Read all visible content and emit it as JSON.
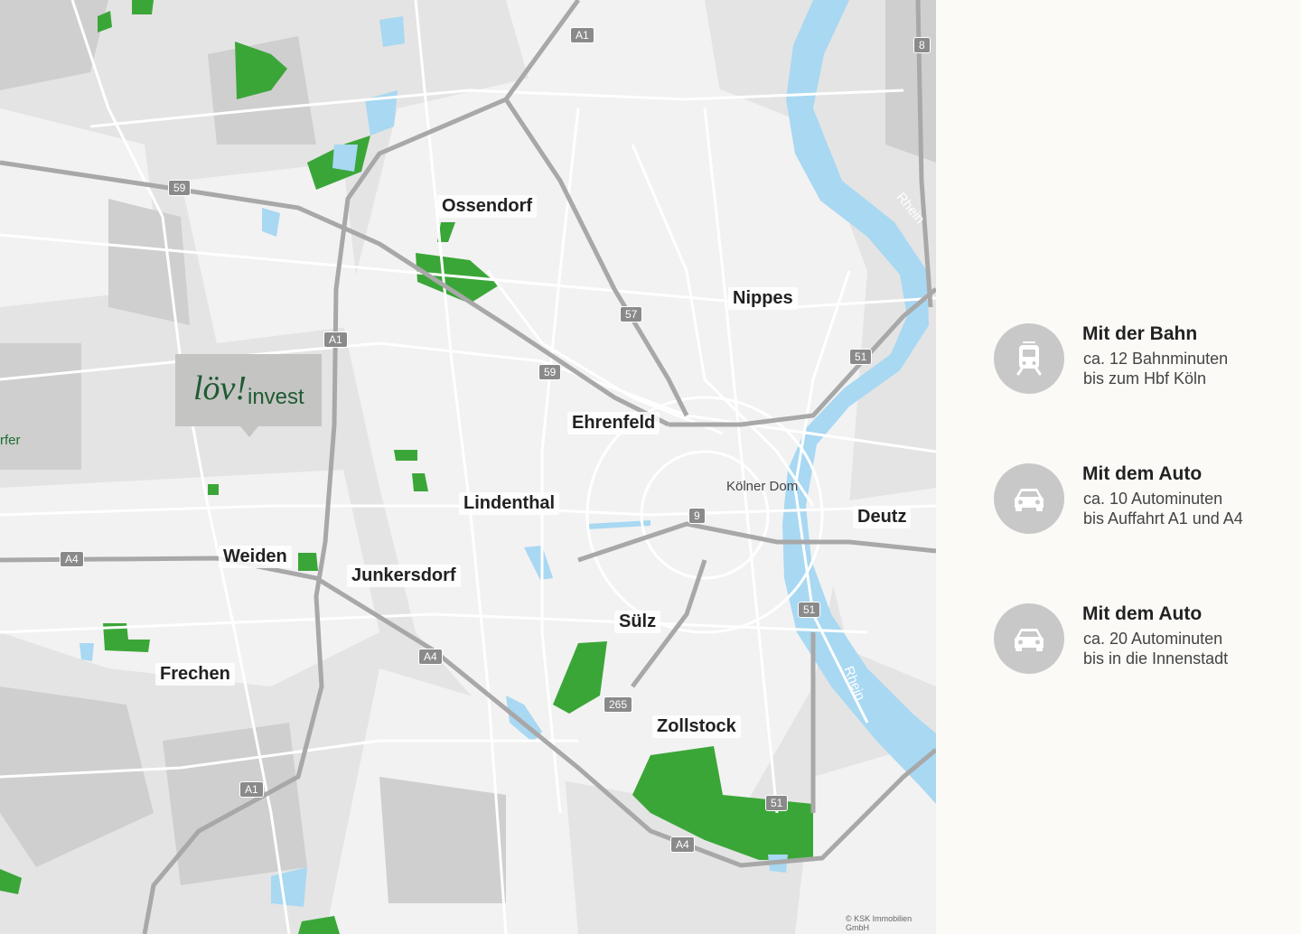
{
  "map": {
    "districts": [
      "Ossendorf",
      "Nippes",
      "Ehrenfeld",
      "Lindenthal",
      "Weiden",
      "Junkersdorf",
      "Deutz",
      "Sülz",
      "Frechen",
      "Zollstock"
    ],
    "poi": "Kölner Dom",
    "river": "Rhein",
    "edge_label": "rfer",
    "road_shields": [
      "A1",
      "A1",
      "A1",
      "A4",
      "A4",
      "A4",
      "57",
      "59",
      "59",
      "8",
      "51",
      "51",
      "51",
      "9",
      "265"
    ],
    "logo": {
      "brand": "löv!",
      "suffix": "invest"
    },
    "copyright": "© KSK Immobilien GmbH",
    "colors": {
      "water": "#a8d8f2",
      "green": "#3ba638",
      "built": "#c9c9c9",
      "background": "#e4e4e4",
      "roads": "#ffffff",
      "highway": "#a8a8a8"
    }
  },
  "legend": [
    {
      "icon": "train-icon",
      "title": "Mit der Bahn",
      "line1": "ca. 12 Bahnminuten",
      "line2": "bis zum Hbf Köln"
    },
    {
      "icon": "car-icon",
      "title": "Mit dem Auto",
      "line1": "ca. 10 Autominuten",
      "line2": "bis Auffahrt A1 und A4"
    },
    {
      "icon": "car-icon",
      "title": "Mit dem Auto",
      "line1": "ca. 20 Autominuten",
      "line2": "bis in die Innenstadt"
    }
  ]
}
